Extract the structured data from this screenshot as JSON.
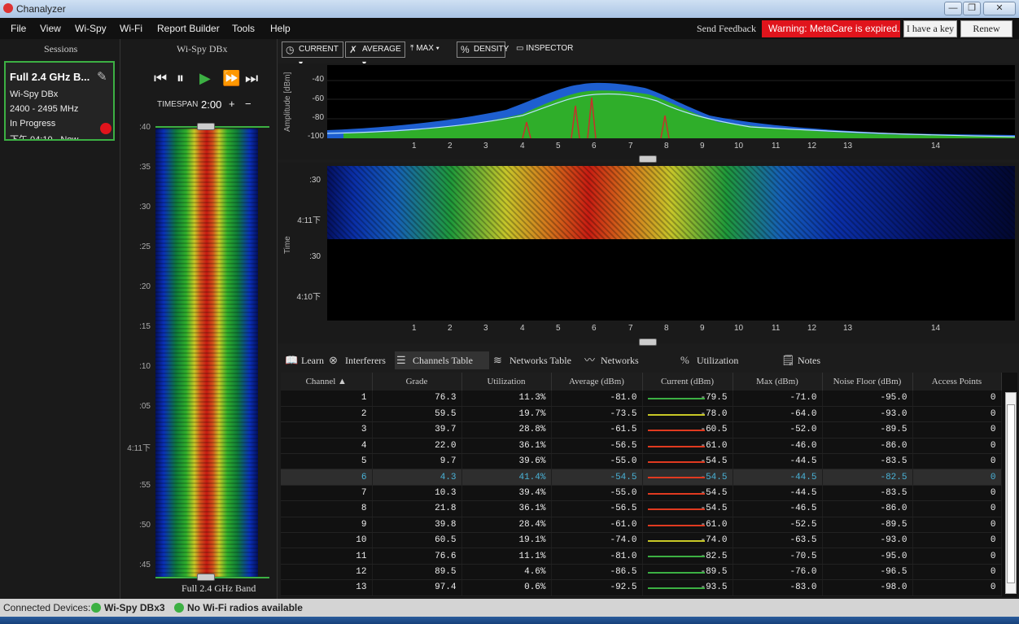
{
  "window": {
    "title": "Chanalyzer",
    "controls": [
      "—",
      "❐",
      "✕"
    ]
  },
  "menu": [
    "File",
    "View",
    "Wi-Spy",
    "Wi-Fi",
    "Report Builder",
    "Tools",
    "Help"
  ],
  "header": {
    "send_feedback": "Send Feedback",
    "warning": "Warning: MetaCare is expired.",
    "have_key": "I have a key",
    "renew": "Renew"
  },
  "sessions": {
    "title": "Sessions",
    "card": {
      "name": "Full 2.4 GHz B...",
      "device": "Wi-Spy DBx",
      "range": "2400 - 2495 MHz",
      "status": "In Progress",
      "time": "下午 04:10 - Now"
    }
  },
  "wispy": {
    "title": "Wi-Spy DBx",
    "timespan_label": "TIMESPAN",
    "timespan": "2:00",
    "time_labels": [
      ":40",
      ":35",
      ":30",
      ":25",
      ":20",
      ":15",
      ":10",
      ":05",
      "4:11下",
      ":55",
      ":50",
      ":45"
    ],
    "band_label": "Full 2.4 GHz Band"
  },
  "toolbar": {
    "current": "CURRENT",
    "average": "AVERAGE",
    "max": "MAX",
    "density": "DENSITY",
    "inspector": "INSPECTOR"
  },
  "spectrum": {
    "ylabel": "Amplitude [dBm]",
    "yticks": [
      "-40",
      "-60",
      "-80",
      "-100"
    ],
    "channels": [
      "1",
      "2",
      "3",
      "4",
      "5",
      "6",
      "7",
      "8",
      "9",
      "10",
      "11",
      "12",
      "13",
      "14"
    ]
  },
  "timewf": {
    "ylabel": "Time",
    "yticks": [
      ":30",
      "4:11下",
      ":30",
      "4:10下"
    ]
  },
  "tabs": [
    "Learn",
    "Interferers",
    "Channels Table",
    "Networks Table",
    "Networks Graph",
    "Utilization Graph",
    "Notes"
  ],
  "table": {
    "headers": [
      "Channel",
      "Grade",
      "Utilization",
      "Average (dBm)",
      "Current (dBm)",
      "Max (dBm)",
      "Noise Floor (dBm)",
      "Access Points"
    ],
    "rows": [
      [
        "1",
        "76.3",
        "11.3%",
        "-81.0",
        "-79.5",
        "-71.0",
        "-95.0",
        "0"
      ],
      [
        "2",
        "59.5",
        "19.7%",
        "-73.5",
        "-78.0",
        "-64.0",
        "-93.0",
        "0"
      ],
      [
        "3",
        "39.7",
        "28.8%",
        "-61.5",
        "-60.5",
        "-52.0",
        "-89.5",
        "0"
      ],
      [
        "4",
        "22.0",
        "36.1%",
        "-56.5",
        "-61.0",
        "-46.0",
        "-86.0",
        "0"
      ],
      [
        "5",
        "9.7",
        "39.6%",
        "-55.0",
        "-54.5",
        "-44.5",
        "-83.5",
        "0"
      ],
      [
        "6",
        "4.3",
        "41.4%",
        "-54.5",
        "-54.5",
        "-44.5",
        "-82.5",
        "0"
      ],
      [
        "7",
        "10.3",
        "39.4%",
        "-55.0",
        "-54.5",
        "-44.5",
        "-83.5",
        "0"
      ],
      [
        "8",
        "21.8",
        "36.1%",
        "-56.5",
        "-54.5",
        "-46.5",
        "-86.0",
        "0"
      ],
      [
        "9",
        "39.8",
        "28.4%",
        "-61.0",
        "-61.0",
        "-52.5",
        "-89.5",
        "0"
      ],
      [
        "10",
        "60.5",
        "19.1%",
        "-74.0",
        "-74.0",
        "-63.5",
        "-93.0",
        "0"
      ],
      [
        "11",
        "76.6",
        "11.1%",
        "-81.0",
        "-82.5",
        "-70.5",
        "-95.0",
        "0"
      ],
      [
        "12",
        "89.5",
        "4.6%",
        "-86.5",
        "-89.5",
        "-76.0",
        "-96.5",
        "0"
      ],
      [
        "13",
        "97.4",
        "0.6%",
        "-92.5",
        "-93.5",
        "-83.0",
        "-98.0",
        "0"
      ]
    ],
    "spark_colors": [
      "#3cb043",
      "#c8c826",
      "#e03a20",
      "#e03a20",
      "#e03a20",
      "#e03a20",
      "#e03a20",
      "#e03a20",
      "#e03a20",
      "#c8c826",
      "#3cb043",
      "#3cb043",
      "#3cb043"
    ],
    "selected_row": 5
  },
  "status": {
    "connected": "Connected Devices:",
    "device": "Wi-Spy DBx3",
    "wifi": "No Wi-Fi radios available"
  }
}
